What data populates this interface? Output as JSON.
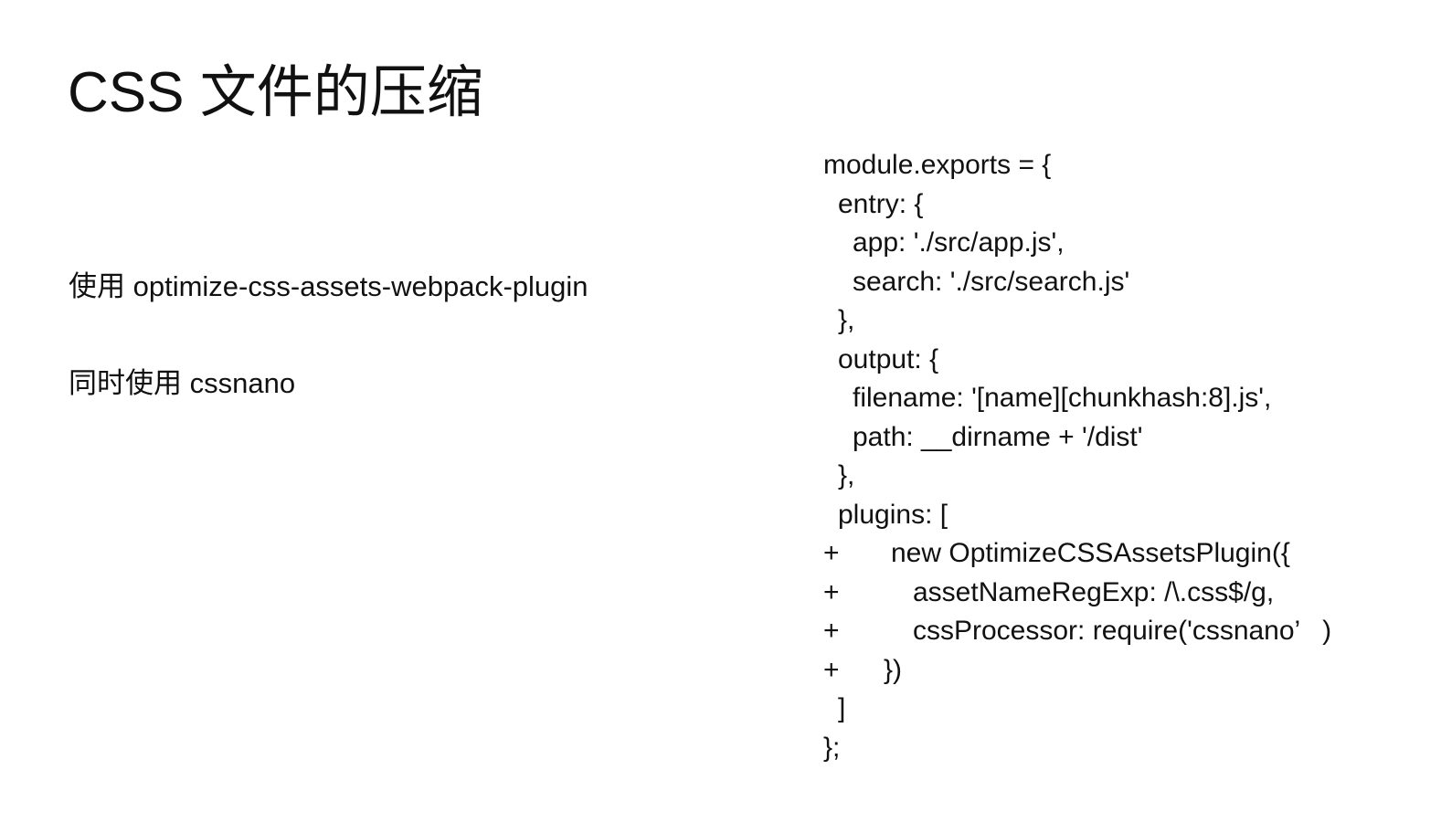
{
  "slide": {
    "title": "CSS 文件的压缩",
    "bullets": [
      "使用 optimize-css-assets-webpack-plugin",
      "同时使用 cssnano"
    ],
    "code": [
      {
        "marker": "",
        "text": "module.exports = {"
      },
      {
        "marker": "",
        "text": "entry: {"
      },
      {
        "marker": "",
        "text": "app: './src/app.js',"
      },
      {
        "marker": "",
        "text": "search: './src/search.js'"
      },
      {
        "marker": "",
        "text": "},"
      },
      {
        "marker": "",
        "text": "output: {"
      },
      {
        "marker": "",
        "text": "filename: '[name][chunkhash:8].js',"
      },
      {
        "marker": "",
        "text": "path: __dirname + '/dist'"
      },
      {
        "marker": "",
        "text": "},"
      },
      {
        "marker": "",
        "text": "plugins: ["
      },
      {
        "marker": "+",
        "text": "new OptimizeCSSAssetsPlugin({"
      },
      {
        "marker": "+",
        "text": "assetNameRegExp: /\\.css$/g,"
      },
      {
        "marker": "+",
        "text": "cssProcessor: require('cssnano’   )"
      },
      {
        "marker": "+",
        "text": "})"
      },
      {
        "marker": "",
        "text": "]"
      },
      {
        "marker": "",
        "text": "};"
      }
    ]
  }
}
